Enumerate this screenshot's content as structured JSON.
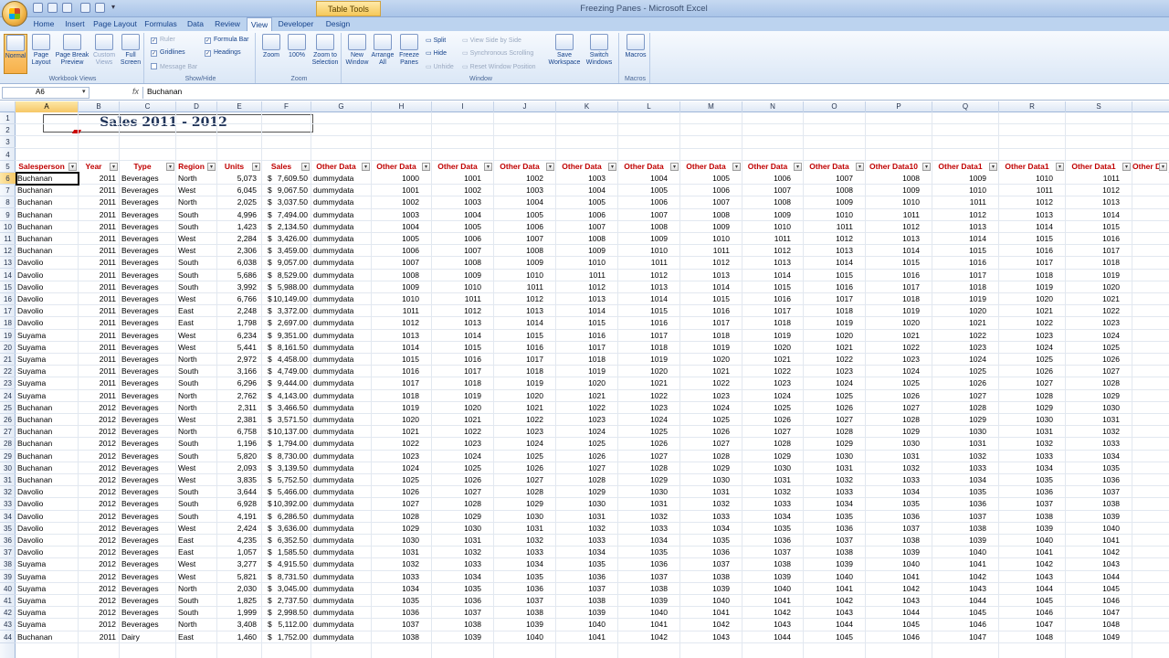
{
  "window": {
    "title": "Freezing Panes - Microsoft Excel",
    "table_tools": "Table Tools"
  },
  "tabs": [
    "Home",
    "Insert",
    "Page Layout",
    "Formulas",
    "Data",
    "Review",
    "View",
    "Developer",
    "Design"
  ],
  "active_tab": "View",
  "ribbon": {
    "workbook_views": {
      "label": "Workbook Views",
      "normal": "Normal",
      "page_layout": "Page Layout",
      "page_break_preview": "Page Break Preview",
      "custom_views": "Custom Views",
      "full_screen": "Full Screen"
    },
    "show_hide": {
      "label": "Show/Hide",
      "ruler": "Ruler",
      "gridlines": "Gridlines",
      "message_bar": "Message Bar",
      "formula_bar": "Formula Bar",
      "headings": "Headings"
    },
    "zoom": {
      "label": "Zoom",
      "zoom": "Zoom",
      "hundred": "100%",
      "zoom_to_selection": "Zoom to Selection"
    },
    "window": {
      "label": "Window",
      "new_window": "New Window",
      "arrange_all": "Arrange All",
      "freeze_panes": "Freeze Panes",
      "split": "Split",
      "hide": "Hide",
      "unhide": "Unhide",
      "view_side_by_side": "View Side by Side",
      "synchronous_scrolling": "Synchronous Scrolling",
      "reset_window_position": "Reset Window Position",
      "save_workspace": "Save Workspace",
      "switch_windows": "Switch Windows"
    },
    "macros": {
      "label": "Macros",
      "macros": "Macros"
    }
  },
  "formula_bar": {
    "name_box": "A6",
    "fx": "fx",
    "value": "Buchanan"
  },
  "columns": [
    "A",
    "B",
    "C",
    "D",
    "E",
    "F",
    "G",
    "H",
    "I",
    "J",
    "K",
    "L",
    "M",
    "N",
    "O",
    "P",
    "Q",
    "R",
    "S"
  ],
  "selected_column": "A",
  "selected_row": "6",
  "sheet_title": "Sales 2011 - 2012",
  "table_headers": [
    "Salesperson",
    "Year",
    "Type",
    "Region",
    "Units",
    "Sales",
    "Other Data",
    "Other Data",
    "Other Data",
    "Other Data",
    "Other Data",
    "Other Data",
    "Other Data",
    "Other Data",
    "Other Data",
    "Other Data10",
    "Other Data1",
    "Other Data1",
    "Other Data1",
    "Other Da"
  ],
  "rows": [
    {
      "n": "6",
      "sp": "Buchanan",
      "yr": "2011",
      "type": "Beverages",
      "reg": "North",
      "units": "5,073",
      "sales": "7,609.50",
      "od": "dummydata",
      "h": "1000"
    },
    {
      "n": "7",
      "sp": "Buchanan",
      "yr": "2011",
      "type": "Beverages",
      "reg": "West",
      "units": "6,045",
      "sales": "9,067.50",
      "od": "dummydata",
      "h": "1001"
    },
    {
      "n": "8",
      "sp": "Buchanan",
      "yr": "2011",
      "type": "Beverages",
      "reg": "North",
      "units": "2,025",
      "sales": "3,037.50",
      "od": "dummydata",
      "h": "1002"
    },
    {
      "n": "9",
      "sp": "Buchanan",
      "yr": "2011",
      "type": "Beverages",
      "reg": "South",
      "units": "4,996",
      "sales": "7,494.00",
      "od": "dummydata",
      "h": "1003"
    },
    {
      "n": "10",
      "sp": "Buchanan",
      "yr": "2011",
      "type": "Beverages",
      "reg": "South",
      "units": "1,423",
      "sales": "2,134.50",
      "od": "dummydata",
      "h": "1004"
    },
    {
      "n": "11",
      "sp": "Buchanan",
      "yr": "2011",
      "type": "Beverages",
      "reg": "West",
      "units": "2,284",
      "sales": "3,426.00",
      "od": "dummydata",
      "h": "1005"
    },
    {
      "n": "12",
      "sp": "Buchanan",
      "yr": "2011",
      "type": "Beverages",
      "reg": "West",
      "units": "2,306",
      "sales": "3,459.00",
      "od": "dummydata",
      "h": "1006"
    },
    {
      "n": "13",
      "sp": "Davolio",
      "yr": "2011",
      "type": "Beverages",
      "reg": "South",
      "units": "6,038",
      "sales": "9,057.00",
      "od": "dummydata",
      "h": "1007"
    },
    {
      "n": "14",
      "sp": "Davolio",
      "yr": "2011",
      "type": "Beverages",
      "reg": "South",
      "units": "5,686",
      "sales": "8,529.00",
      "od": "dummydata",
      "h": "1008"
    },
    {
      "n": "15",
      "sp": "Davolio",
      "yr": "2011",
      "type": "Beverages",
      "reg": "South",
      "units": "3,992",
      "sales": "5,988.00",
      "od": "dummydata",
      "h": "1009"
    },
    {
      "n": "16",
      "sp": "Davolio",
      "yr": "2011",
      "type": "Beverages",
      "reg": "West",
      "units": "6,766",
      "sales": "10,149.00",
      "od": "dummydata",
      "h": "1010"
    },
    {
      "n": "17",
      "sp": "Davolio",
      "yr": "2011",
      "type": "Beverages",
      "reg": "East",
      "units": "2,248",
      "sales": "3,372.00",
      "od": "dummydata",
      "h": "1011"
    },
    {
      "n": "18",
      "sp": "Davolio",
      "yr": "2011",
      "type": "Beverages",
      "reg": "East",
      "units": "1,798",
      "sales": "2,697.00",
      "od": "dummydata",
      "h": "1012"
    },
    {
      "n": "19",
      "sp": "Suyama",
      "yr": "2011",
      "type": "Beverages",
      "reg": "West",
      "units": "6,234",
      "sales": "9,351.00",
      "od": "dummydata",
      "h": "1013"
    },
    {
      "n": "20",
      "sp": "Suyama",
      "yr": "2011",
      "type": "Beverages",
      "reg": "West",
      "units": "5,441",
      "sales": "8,161.50",
      "od": "dummydata",
      "h": "1014"
    },
    {
      "n": "21",
      "sp": "Suyama",
      "yr": "2011",
      "type": "Beverages",
      "reg": "North",
      "units": "2,972",
      "sales": "4,458.00",
      "od": "dummydata",
      "h": "1015"
    },
    {
      "n": "22",
      "sp": "Suyama",
      "yr": "2011",
      "type": "Beverages",
      "reg": "South",
      "units": "3,166",
      "sales": "4,749.00",
      "od": "dummydata",
      "h": "1016"
    },
    {
      "n": "23",
      "sp": "Suyama",
      "yr": "2011",
      "type": "Beverages",
      "reg": "South",
      "units": "6,296",
      "sales": "9,444.00",
      "od": "dummydata",
      "h": "1017"
    },
    {
      "n": "24",
      "sp": "Suyama",
      "yr": "2011",
      "type": "Beverages",
      "reg": "North",
      "units": "2,762",
      "sales": "4,143.00",
      "od": "dummydata",
      "h": "1018"
    },
    {
      "n": "25",
      "sp": "Buchanan",
      "yr": "2012",
      "type": "Beverages",
      "reg": "North",
      "units": "2,311",
      "sales": "3,466.50",
      "od": "dummydata",
      "h": "1019"
    },
    {
      "n": "26",
      "sp": "Buchanan",
      "yr": "2012",
      "type": "Beverages",
      "reg": "West",
      "units": "2,381",
      "sales": "3,571.50",
      "od": "dummydata",
      "h": "1020"
    },
    {
      "n": "27",
      "sp": "Buchanan",
      "yr": "2012",
      "type": "Beverages",
      "reg": "North",
      "units": "6,758",
      "sales": "10,137.00",
      "od": "dummydata",
      "h": "1021"
    },
    {
      "n": "28",
      "sp": "Buchanan",
      "yr": "2012",
      "type": "Beverages",
      "reg": "South",
      "units": "1,196",
      "sales": "1,794.00",
      "od": "dummydata",
      "h": "1022"
    },
    {
      "n": "29",
      "sp": "Buchanan",
      "yr": "2012",
      "type": "Beverages",
      "reg": "South",
      "units": "5,820",
      "sales": "8,730.00",
      "od": "dummydata",
      "h": "1023"
    },
    {
      "n": "30",
      "sp": "Buchanan",
      "yr": "2012",
      "type": "Beverages",
      "reg": "West",
      "units": "2,093",
      "sales": "3,139.50",
      "od": "dummydata",
      "h": "1024"
    },
    {
      "n": "31",
      "sp": "Buchanan",
      "yr": "2012",
      "type": "Beverages",
      "reg": "West",
      "units": "3,835",
      "sales": "5,752.50",
      "od": "dummydata",
      "h": "1025"
    },
    {
      "n": "32",
      "sp": "Davolio",
      "yr": "2012",
      "type": "Beverages",
      "reg": "South",
      "units": "3,644",
      "sales": "5,466.00",
      "od": "dummydata",
      "h": "1026"
    },
    {
      "n": "33",
      "sp": "Davolio",
      "yr": "2012",
      "type": "Beverages",
      "reg": "South",
      "units": "6,928",
      "sales": "10,392.00",
      "od": "dummydata",
      "h": "1027"
    },
    {
      "n": "34",
      "sp": "Davolio",
      "yr": "2012",
      "type": "Beverages",
      "reg": "South",
      "units": "4,191",
      "sales": "6,286.50",
      "od": "dummydata",
      "h": "1028"
    },
    {
      "n": "35",
      "sp": "Davolio",
      "yr": "2012",
      "type": "Beverages",
      "reg": "West",
      "units": "2,424",
      "sales": "3,636.00",
      "od": "dummydata",
      "h": "1029"
    },
    {
      "n": "36",
      "sp": "Davolio",
      "yr": "2012",
      "type": "Beverages",
      "reg": "East",
      "units": "4,235",
      "sales": "6,352.50",
      "od": "dummydata",
      "h": "1030"
    },
    {
      "n": "37",
      "sp": "Davolio",
      "yr": "2012",
      "type": "Beverages",
      "reg": "East",
      "units": "1,057",
      "sales": "1,585.50",
      "od": "dummydata",
      "h": "1031"
    },
    {
      "n": "38",
      "sp": "Suyama",
      "yr": "2012",
      "type": "Beverages",
      "reg": "West",
      "units": "3,277",
      "sales": "4,915.50",
      "od": "dummydata",
      "h": "1032"
    },
    {
      "n": "39",
      "sp": "Suyama",
      "yr": "2012",
      "type": "Beverages",
      "reg": "West",
      "units": "5,821",
      "sales": "8,731.50",
      "od": "dummydata",
      "h": "1033"
    },
    {
      "n": "40",
      "sp": "Suyama",
      "yr": "2012",
      "type": "Beverages",
      "reg": "North",
      "units": "2,030",
      "sales": "3,045.00",
      "od": "dummydata",
      "h": "1034"
    },
    {
      "n": "41",
      "sp": "Suyama",
      "yr": "2012",
      "type": "Beverages",
      "reg": "South",
      "units": "1,825",
      "sales": "2,737.50",
      "od": "dummydata",
      "h": "1035"
    },
    {
      "n": "42",
      "sp": "Suyama",
      "yr": "2012",
      "type": "Beverages",
      "reg": "South",
      "units": "1,999",
      "sales": "2,998.50",
      "od": "dummydata",
      "h": "1036"
    },
    {
      "n": "43",
      "sp": "Suyama",
      "yr": "2012",
      "type": "Beverages",
      "reg": "North",
      "units": "3,408",
      "sales": "5,112.00",
      "od": "dummydata",
      "h": "1037"
    },
    {
      "n": "44",
      "sp": "Buchanan",
      "yr": "2011",
      "type": "Dairy",
      "reg": "East",
      "units": "1,460",
      "sales": "1,752.00",
      "od": "dummydata",
      "h": "1038"
    }
  ],
  "currency": "$",
  "colors": {
    "header_red": "#c00000",
    "accent_orange": "#f6c766",
    "ribbon_blue": "#15428b"
  }
}
